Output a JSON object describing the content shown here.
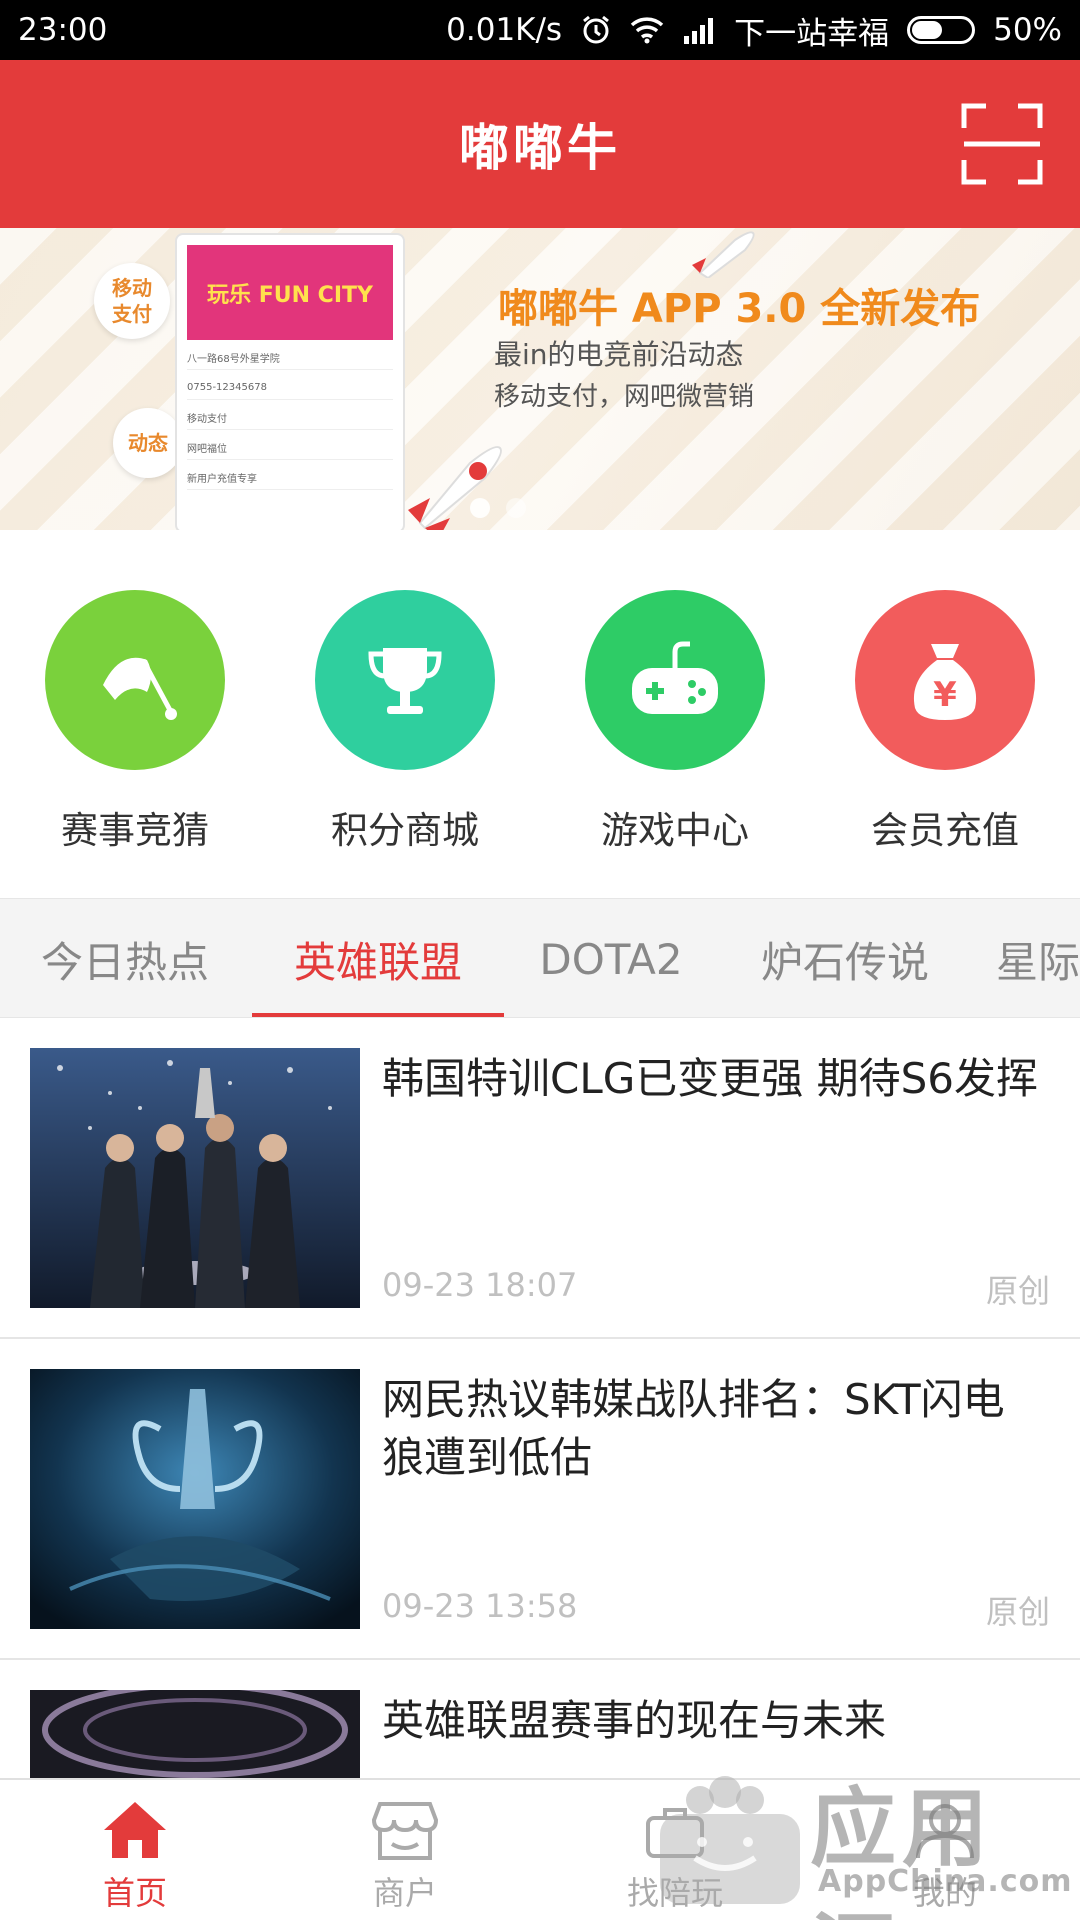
{
  "status_bar": {
    "time": "23:00",
    "speed": "0.01K/s",
    "carrier": "下一站幸福",
    "battery": "50%"
  },
  "header": {
    "title": "嘟嘟牛",
    "scan_icon": "scan-icon"
  },
  "banner": {
    "left_badges": [
      "移动\n支付",
      "动态"
    ],
    "phone_title": "玩乐 FUN CITY",
    "phone_rows": [
      "八一路68号外星学院",
      "0755-12345678",
      "移动支付",
      "网吧福位",
      "新用户充值专享"
    ],
    "headline": "嘟嘟牛 APP 3.0 全新发布",
    "sub1": "最in的电竞前沿动态",
    "sub2": "移动支付，网吧微营销",
    "page_count": 2,
    "current_page": 1
  },
  "categories": [
    {
      "label": "赛事竞猜",
      "icon": "flag-icon",
      "color": "#7ad13c"
    },
    {
      "label": "积分商城",
      "icon": "trophy-icon",
      "color": "#2fcf9e"
    },
    {
      "label": "游戏中心",
      "icon": "gamepad-icon",
      "color": "#2ecc66"
    },
    {
      "label": "会员充值",
      "icon": "money-bag-icon",
      "color": "#f25c5c"
    }
  ],
  "tabs": [
    {
      "label": "今日热点",
      "active": false
    },
    {
      "label": "英雄联盟",
      "active": true
    },
    {
      "label": "DOTA2",
      "active": false
    },
    {
      "label": "炉石传说",
      "active": false
    },
    {
      "label": "星际",
      "active": false
    }
  ],
  "news": [
    {
      "title": "韩国特训CLG已变更强 期待S6发挥",
      "time": "09-23 18:07",
      "tag": "原创"
    },
    {
      "title": "网民热议韩媒战队排名：SKT闪电狼遭到低估",
      "time": "09-23 13:58",
      "tag": "原创"
    },
    {
      "title": "英雄联盟赛事的现在与未来",
      "time": "",
      "tag": ""
    }
  ],
  "bottom_nav": [
    {
      "label": "首页",
      "icon": "home-icon",
      "active": true
    },
    {
      "label": "商户",
      "icon": "store-icon",
      "active": false
    },
    {
      "label": "找陪玩",
      "icon": "partner-icon",
      "active": false
    },
    {
      "label": "我的",
      "icon": "profile-icon",
      "active": false
    }
  ],
  "watermark": {
    "text": "应用汇",
    "sub": "AppChina.com"
  },
  "colors": {
    "brand_red": "#e33b3b",
    "tab_active": "#e33b3b",
    "muted": "#c0c0c0"
  }
}
